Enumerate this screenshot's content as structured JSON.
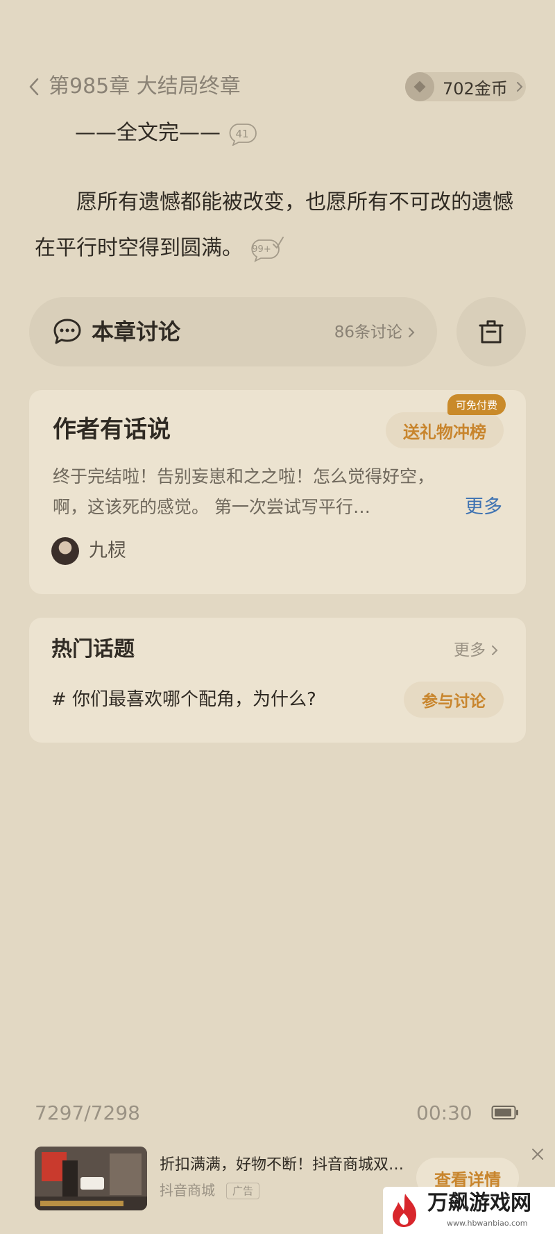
{
  "header": {
    "chapter_title": "第985章 大结局终章",
    "coins": "702金币"
  },
  "reading": {
    "end_mark": "——全文完——",
    "end_mark_comment_count": "41",
    "paragraph_lines": [
      "愿所有遗憾都能被改变，也愿所有不可改的遗憾",
      "在平行时空得到圆满。"
    ],
    "paragraph_comment_count": "99+"
  },
  "discussion": {
    "label": "本章讨论",
    "count": "86条讨论"
  },
  "author_note": {
    "title": "作者有话说",
    "gift_button": "送礼物冲榜",
    "gift_badge": "可免付费",
    "text_lines": [
      "终于完结啦！告别妄崽和之之啦！怎么觉得好空，",
      "啊，这该死的感觉。 第一次尝试写平行…"
    ],
    "more": "更多",
    "author_name": "九棂"
  },
  "hot_topics": {
    "title": "热门话题",
    "more": "更多",
    "topic": "# 你们最喜欢哪个配角，为什么?",
    "join_button": "参与讨论"
  },
  "status": {
    "page_progress": "7297/7298",
    "time": "00:30"
  },
  "ad": {
    "title": "折扣满满，好物不断！抖音商城双…",
    "source": "抖音商城",
    "tag": "广告",
    "cta": "查看详情"
  },
  "watermark": {
    "title": "万飙游戏网",
    "url": "www.hbwanbiao.com"
  },
  "colors": {
    "background": "#e2d8c3",
    "card": "#ece3d0",
    "accent_orange": "#c8852d",
    "link_blue": "#3f73b2"
  }
}
